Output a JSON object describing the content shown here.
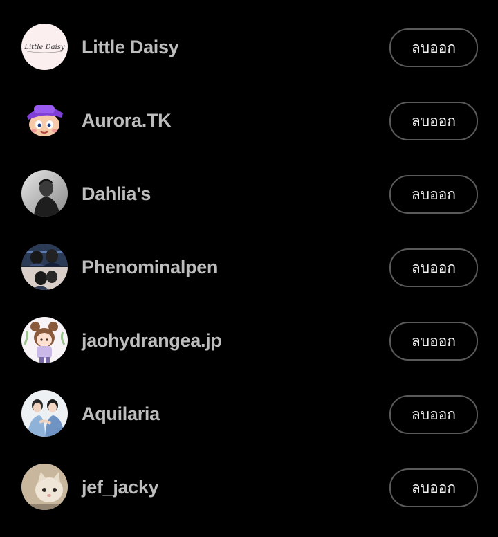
{
  "accounts": [
    {
      "name": "Little Daisy",
      "avatar": "little-daisy-logo-avatar",
      "logo_text": "Little Daisy",
      "action_label": "ลบออก"
    },
    {
      "name": "Aurora.TK",
      "avatar": "cartoon-character-purple-hat-avatar",
      "action_label": "ลบออก"
    },
    {
      "name": "Dahlia's",
      "avatar": "monochrome-portrait-avatar",
      "action_label": "ลบออก"
    },
    {
      "name": "Phenominalpen",
      "avatar": "couple-photo-split-avatar",
      "action_label": "ลบออก"
    },
    {
      "name": "jaohydrangea.jp",
      "avatar": "chibi-girl-illustration-avatar",
      "action_label": "ลบออก"
    },
    {
      "name": "Aquilaria",
      "avatar": "two-people-photo-avatar",
      "action_label": "ลบออก"
    },
    {
      "name": "jef_jacky",
      "avatar": "cat-photo-avatar",
      "action_label": "ลบออก"
    }
  ]
}
